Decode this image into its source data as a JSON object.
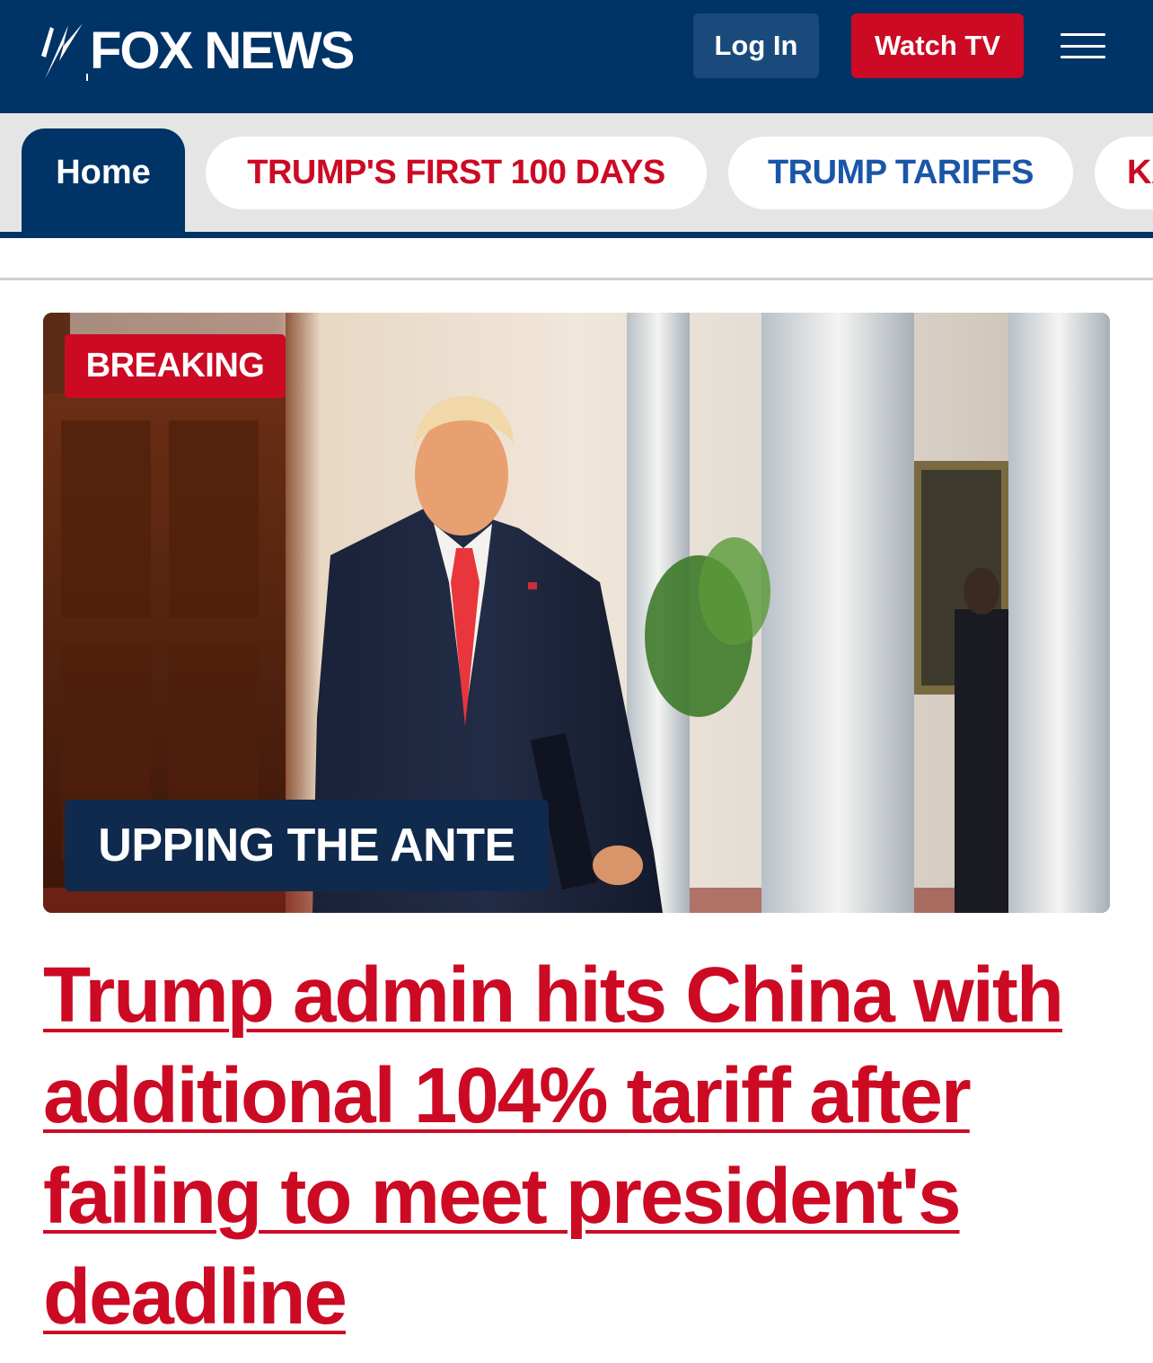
{
  "header": {
    "logo_text": "FOX NEWS",
    "login_label": "Log In",
    "watch_label": "Watch TV"
  },
  "nav": {
    "tabs": [
      {
        "label": "Home"
      },
      {
        "label": "TRUMP'S FIRST 100 DAYS"
      },
      {
        "label": "TRUMP TARIFFS"
      },
      {
        "label": "KA"
      }
    ]
  },
  "hero": {
    "breaking_label": "BREAKING",
    "kicker": "UPPING THE ANTE",
    "headline": "Trump admin hits China with additional 104% tariff after failing to meet president's deadline"
  },
  "colors": {
    "header_bg": "#003366",
    "accent_red": "#cc0a24",
    "tab_blue": "#1a56a8",
    "nav_bg": "#e5e5e5"
  }
}
